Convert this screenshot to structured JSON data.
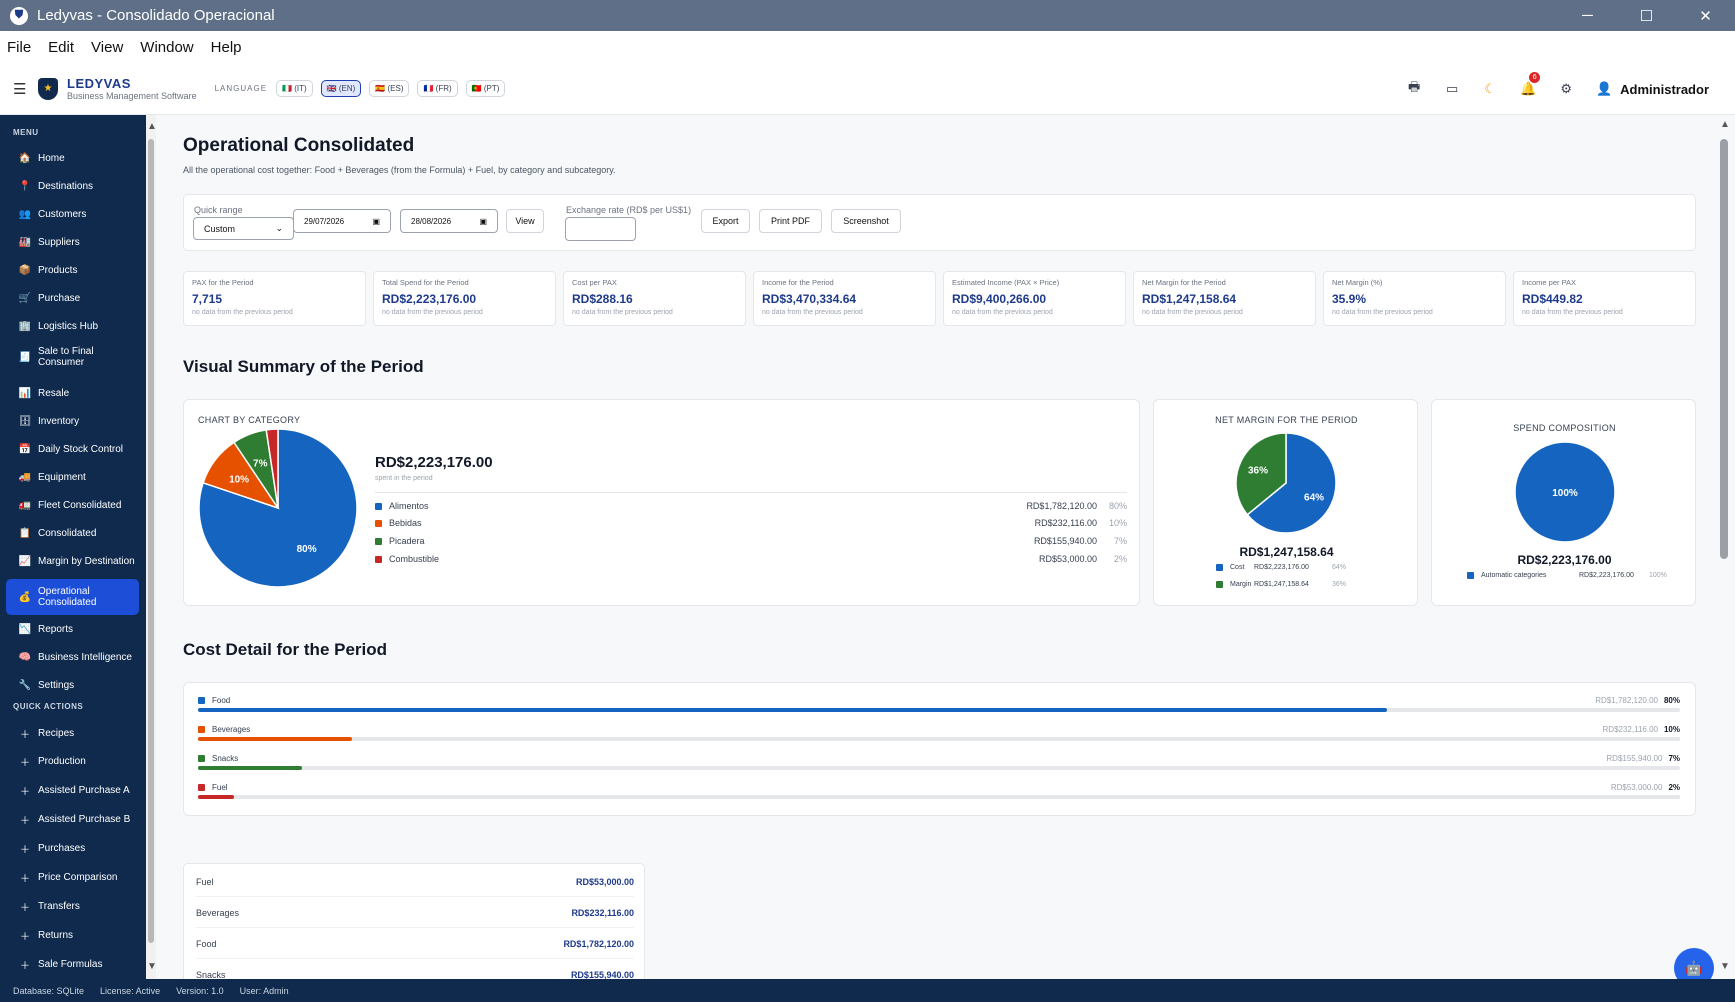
{
  "window": {
    "title": "Ledyvas - Consolidado Operacional",
    "minimize": "─",
    "maximize": "☐",
    "close": "✕"
  },
  "menu": [
    "File",
    "Edit",
    "View",
    "Window",
    "Help"
  ],
  "header": {
    "brand": "LEDYVAS",
    "tagline": "Business Management Software",
    "language_label": "LANGUAGE",
    "languages": [
      "🇮🇹 (IT)",
      "🇬🇧 (EN)",
      "🇪🇸 (ES)",
      "🇫🇷 (FR)",
      "🇵🇹 (PT)"
    ],
    "icons": [
      "printer-icon",
      "terminal-icon",
      "moon-icon",
      "bell-icon",
      "settings-icon"
    ],
    "notifications": "6",
    "user": "Administrador"
  },
  "sidebar": {
    "menu_label": "MENU",
    "quick_label": "QUICK ACTIONS",
    "items": [
      "Home",
      "Destinations",
      "Customers",
      "Suppliers",
      "Products",
      "Purchase",
      "Logistics Hub",
      "Sale to Final Consumer",
      "Resale",
      "Inventory",
      "Daily Stock Control",
      "Equipment",
      "Fleet Consolidated",
      "Consolidated",
      "Margin by Destination",
      "Operational Consolidated",
      "Reports",
      "Business Intelligence",
      "Settings"
    ],
    "quick": [
      "Recipes",
      "Production",
      "Assisted Purchase A",
      "Assisted Purchase B",
      "Purchases",
      "Price Comparison",
      "Transfers",
      "Returns",
      "Sale Formulas"
    ]
  },
  "page": {
    "title": "Operational Consolidated",
    "subtitle": "All the operational cost together: Food + Beverages (from the Formula) + Fuel, by category and subcategory."
  },
  "filters": {
    "quick_label": "Quick range",
    "quick_value": "Custom",
    "date_from": "29/07/2026",
    "date_to": "28/08/2026",
    "view": "View",
    "exchange_label": "Exchange rate (RD$ per US$1)",
    "exchange_value": "",
    "export": "Export",
    "print": "Print PDF",
    "screenshot": "Screenshot"
  },
  "kpis": [
    {
      "label": "PAX for the Period",
      "value": "7,715",
      "note": "no data from the previous period"
    },
    {
      "label": "Total Spend for the Period",
      "value": "RD$2,223,176.00",
      "note": "no data from the previous period"
    },
    {
      "label": "Cost per PAX",
      "value": "RD$288.16",
      "note": "no data from the previous period"
    },
    {
      "label": "Income for the Period",
      "value": "RD$3,470,334.64",
      "note": "no data from the previous period"
    },
    {
      "label": "Estimated Income (PAX × Price)",
      "value": "RD$9,400,266.00",
      "note": "no data from the previous period"
    },
    {
      "label": "Net Margin for the Period",
      "value": "RD$1,247,158.64",
      "note": "no data from the previous period"
    },
    {
      "label": "Net Margin (%)",
      "value": "35.9%",
      "note": "no data from the previous period"
    },
    {
      "label": "Income per PAX",
      "value": "RD$449.82",
      "note": "no data from the previous period"
    }
  ],
  "visual": {
    "heading": "Visual Summary of the Period",
    "cat_title": "CHART BY CATEGORY",
    "cat_total": "RD$2,223,176.00",
    "cat_caption": "spent in the period",
    "cat_rows": [
      {
        "name": "Alimentos",
        "amount": "RD$1,782,120.00",
        "pct": "80%"
      },
      {
        "name": "Bebidas",
        "amount": "RD$232,116.00",
        "pct": "10%"
      },
      {
        "name": "Picadera",
        "amount": "RD$155,940.00",
        "pct": "7%"
      },
      {
        "name": "Combustible",
        "amount": "RD$53,000.00",
        "pct": "2%"
      }
    ],
    "margin_title": "NET MARGIN FOR THE PERIOD",
    "margin_value": "RD$1,247,158.64",
    "margin_rows": [
      {
        "name": "Cost",
        "amount": "RD$2,223,176.00",
        "pct": "64%"
      },
      {
        "name": "Margin",
        "amount": "RD$1,247,158.64",
        "pct": "36%"
      }
    ],
    "comp_title": "SPEND COMPOSITION",
    "comp_value": "RD$2,223,176.00",
    "comp_row": {
      "name": "Automatic categories",
      "amount": "RD$2,223,176.00",
      "pct": "100%"
    }
  },
  "detail": {
    "heading": "Cost Detail for the Period",
    "rows": [
      {
        "name": "Food",
        "amount": "RD$1,782,120.00",
        "pct": "80%"
      },
      {
        "name": "Beverages",
        "amount": "RD$232,116.00",
        "pct": "10%"
      },
      {
        "name": "Snacks",
        "amount": "RD$155,940.00",
        "pct": "7%"
      },
      {
        "name": "Fuel",
        "amount": "RD$53,000.00",
        "pct": "2%"
      }
    ]
  },
  "table": [
    {
      "name": "Fuel",
      "amount": "RD$53,000.00"
    },
    {
      "name": "Beverages",
      "amount": "RD$232,116.00"
    },
    {
      "name": "Food",
      "amount": "RD$1,782,120.00"
    },
    {
      "name": "Snacks",
      "amount": "RD$155,940.00"
    }
  ],
  "status": [
    "Database: SQLite",
    "License: Active",
    "Version: 1.0",
    "User: Admin"
  ],
  "colors": {
    "blue": "#1565c0",
    "orange": "#e65100",
    "green": "#2e7d32",
    "red": "#c62828"
  },
  "chart_data": [
    {
      "type": "pie",
      "title": "CHART BY CATEGORY",
      "categories": [
        "Alimentos",
        "Bebidas",
        "Picadera",
        "Combustible"
      ],
      "values": [
        1782120,
        232116,
        155940,
        53000
      ],
      "labels": [
        "80%",
        "10%",
        "7%",
        "2%"
      ]
    },
    {
      "type": "pie",
      "title": "NET MARGIN FOR THE PERIOD",
      "categories": [
        "Cost",
        "Margin"
      ],
      "values": [
        2223176,
        1247158.64
      ],
      "labels": [
        "64%",
        "36%"
      ]
    },
    {
      "type": "pie",
      "title": "SPEND COMPOSITION",
      "categories": [
        "Automatic categories"
      ],
      "values": [
        2223176
      ],
      "labels": [
        "100%"
      ]
    },
    {
      "type": "bar",
      "title": "Cost Detail for the Period",
      "categories": [
        "Food",
        "Beverages",
        "Snacks",
        "Fuel"
      ],
      "values": [
        80.2,
        10.4,
        7.0,
        2.4
      ]
    }
  ]
}
